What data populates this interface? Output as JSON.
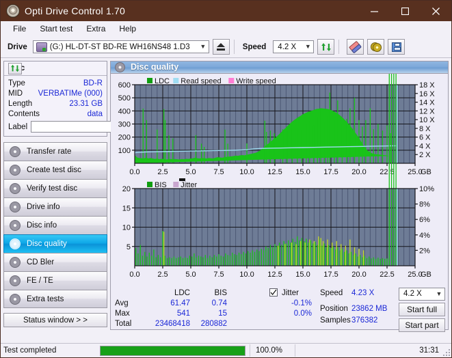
{
  "window": {
    "title": "Opti Drive Control 1.70",
    "minimize": "—",
    "maximize": "□",
    "close": "✕"
  },
  "menu": [
    "File",
    "Start test",
    "Extra",
    "Help"
  ],
  "toolbar": {
    "drive_label": "Drive",
    "drive_value": "(G:)  HL-DT-ST BD-RE  WH16NS48 1.D3",
    "eject_title": "Eject",
    "speed_label": "Speed",
    "speed_value": "4.2 X",
    "refresh_title": "Refresh",
    "erase_title": "Erase",
    "disc_title": "Disc tools",
    "save_title": "Save"
  },
  "disc": {
    "header": "Disc",
    "refresh_title": "Refresh disc info",
    "rows": [
      {
        "key": "Type",
        "value": "BD-R"
      },
      {
        "key": "MID",
        "value": "VERBATIMe (000)"
      },
      {
        "key": "Length",
        "value": "23.31 GB"
      },
      {
        "key": "Contents",
        "value": "data"
      }
    ],
    "label_key": "Label",
    "label_value": "",
    "label_placeholder": ""
  },
  "nav": [
    {
      "label": "Transfer rate",
      "selected": false
    },
    {
      "label": "Create test disc",
      "selected": false
    },
    {
      "label": "Verify test disc",
      "selected": false
    },
    {
      "label": "Drive info",
      "selected": false
    },
    {
      "label": "Disc info",
      "selected": false
    },
    {
      "label": "Disc quality",
      "selected": true
    },
    {
      "label": "CD Bler",
      "selected": false
    },
    {
      "label": "FE / TE",
      "selected": false
    },
    {
      "label": "Extra tests",
      "selected": false
    }
  ],
  "status_window_button": "Status window > >",
  "panel": {
    "title": "Disc quality"
  },
  "stats": {
    "col_ldc": "LDC",
    "col_bis": "BIS",
    "rows": [
      {
        "key": "Avg",
        "ldc": "61.47",
        "bis": "0.74"
      },
      {
        "key": "Max",
        "ldc": "541",
        "bis": "15"
      },
      {
        "key": "Total",
        "ldc": "23468418",
        "bis": "280882"
      }
    ],
    "jitter_label": "Jitter",
    "jitter_checked": true,
    "jitter_avg": "-0.1%",
    "jitter_max": "0.0%",
    "speed_key": "Speed",
    "speed_value": "4.23 X",
    "position_key": "Position",
    "position_value": "23862 MB",
    "samples_key": "Samples",
    "samples_value": "376382",
    "speed_select": "4.2 X",
    "start_full": "Start full",
    "start_part": "Start part"
  },
  "statusbar": {
    "text": "Test completed",
    "progress_pct": 100,
    "percent_label": "100.0%",
    "time": "31:31"
  },
  "colors": {
    "title_bar": "#58301f",
    "plot_bg": "#6e7c96",
    "ldc_green": "#19c319",
    "read_speed": "#9fdcf2",
    "write_speed": "#ff7ed4",
    "jitter": "#c9a6cf",
    "value_blue": "#1a27d6",
    "progress_green": "#18a018",
    "sel_blue": "#0fa8e8"
  },
  "chart_data": [
    {
      "type": "area",
      "id": "ldc-chart",
      "title": "",
      "legend": [
        {
          "label": "LDC",
          "color": "#119e11"
        },
        {
          "label": "Read speed",
          "color": "#9fdcf2"
        },
        {
          "label": "Write speed",
          "color": "#ff7ed4"
        }
      ],
      "legend_position": "top-left",
      "xlabel": "GB",
      "ylabel": "",
      "xlim": [
        0.0,
        25.0
      ],
      "xticks": [
        0.0,
        2.5,
        5.0,
        7.5,
        10.0,
        12.5,
        15.0,
        17.5,
        20.0,
        22.5,
        25.0
      ],
      "xticklabels": [
        "0.0",
        "2.5",
        "5.0",
        "7.5",
        "10.0",
        "12.5",
        "15.0",
        "17.5",
        "20.0",
        "22.5",
        "25.0"
      ],
      "ylim": [
        0,
        600
      ],
      "yticks": [
        100,
        200,
        300,
        400,
        500,
        600
      ],
      "yticklabels": [
        "100",
        "200",
        "300",
        "400",
        "500",
        "600"
      ],
      "y2lim": [
        0,
        18
      ],
      "y2ticks": [
        2,
        4,
        6,
        8,
        10,
        12,
        14,
        16,
        18
      ],
      "y2ticklabels": [
        "2 X",
        "4 X",
        "6 X",
        "8 X",
        "10 X",
        "12 X",
        "14 X",
        "16 X",
        "18 X"
      ],
      "grid": true,
      "data_end_gb": 23.4,
      "series": [
        {
          "name": "LDC",
          "color": "#19c319",
          "type": "area",
          "x": [
            0.0,
            0.2,
            0.4,
            0.6,
            0.8,
            1.0,
            1.2,
            1.4,
            1.6,
            1.8,
            2.0,
            2.2,
            2.4,
            2.6,
            2.8,
            3.0,
            3.2,
            3.4,
            3.6,
            3.8,
            4.0,
            4.2,
            4.4,
            4.6,
            4.8,
            5.0,
            5.2,
            5.4,
            5.6,
            5.8,
            6.0,
            6.2,
            6.4,
            6.6,
            6.8,
            7.0,
            7.2,
            7.4,
            7.6,
            7.8,
            8.0,
            8.2,
            8.4,
            8.6,
            8.8,
            9.0,
            9.2,
            9.4,
            9.6,
            9.8,
            10.0,
            10.2,
            10.4,
            10.6,
            10.8,
            11.0,
            11.2,
            11.4,
            11.6,
            11.8,
            12.0,
            12.2,
            12.4,
            12.6,
            12.8,
            13.0,
            13.2,
            13.4,
            13.6,
            13.8,
            14.0,
            14.2,
            14.4,
            14.6,
            14.8,
            15.0,
            15.2,
            15.4,
            15.6,
            15.8,
            16.0,
            16.2,
            16.4,
            16.6,
            16.8,
            17.0,
            17.2,
            17.4,
            17.6,
            17.8,
            18.0,
            18.2,
            18.4,
            18.6,
            18.8,
            19.0,
            19.2,
            19.4,
            19.6,
            19.8,
            20.0,
            20.2,
            20.4,
            20.6,
            20.8,
            21.0,
            21.2,
            21.4,
            21.6,
            21.8,
            22.0,
            22.2,
            22.4,
            22.6,
            22.8,
            23.0,
            23.2,
            23.4
          ],
          "y": [
            60,
            42,
            38,
            36,
            34,
            40,
            34,
            38,
            34,
            30,
            34,
            28,
            32,
            30,
            26,
            28,
            30,
            28,
            30,
            28,
            26,
            30,
            28,
            32,
            30,
            34,
            36,
            40,
            36,
            34,
            38,
            36,
            34,
            38,
            36,
            34,
            40,
            44,
            42,
            40,
            44,
            46,
            48,
            50,
            52,
            56,
            54,
            58,
            60,
            58,
            62,
            66,
            70,
            74,
            78,
            86,
            96,
            110,
            126,
            140,
            152,
            168,
            182,
            196,
            212,
            228,
            246,
            262,
            280,
            296,
            312,
            326,
            338,
            350,
            360,
            372,
            380,
            388,
            394,
            400,
            406,
            412,
            414,
            418,
            416,
            414,
            412,
            408,
            400,
            392,
            382,
            370,
            356,
            340,
            322,
            304,
            284,
            262,
            238,
            214,
            188,
            160,
            132,
            108,
            92,
            80,
            72,
            68,
            66,
            64,
            62,
            60,
            58,
            56
          ]
        },
        {
          "name": "LDC spikes",
          "color": "#19c319",
          "type": "impulse",
          "x": [
            0.75,
            1.05,
            2.0,
            2.6,
            2.72,
            3.05,
            3.4,
            5.45,
            5.95,
            6.2,
            8.05,
            8.3,
            10.0,
            11.6,
            11.75,
            12.1,
            12.45,
            13.2,
            13.6,
            14.05,
            14.5,
            14.9,
            15.3,
            15.6,
            15.95,
            16.3,
            16.6,
            16.9,
            17.2,
            17.4,
            17.8,
            18.1,
            18.5,
            18.9,
            19.2,
            19.6,
            20.0,
            20.3,
            20.6,
            21.0,
            21.3,
            21.7,
            22.1,
            22.5,
            22.8,
            23.1
          ],
          "y": [
            418,
            330,
            258,
            414,
            330,
            214,
            190,
            215,
            150,
            125,
            257,
            150,
            152,
            325,
            240,
            250,
            230,
            260,
            245,
            300,
            270,
            255,
            300,
            325,
            290,
            350,
            420,
            310,
            360,
            540,
            330,
            480,
            300,
            340,
            420,
            500,
            330,
            280,
            330,
            420,
            260,
            300,
            250,
            290,
            230,
            200
          ]
        },
        {
          "name": "Read speed",
          "color": "#9fdcf2",
          "type": "line",
          "axis": "right",
          "x": [
            0.0,
            0.3,
            1.0,
            2.0,
            3.0,
            4.0,
            5.0,
            6.0,
            7.0,
            8.0,
            9.0,
            10.0,
            10.6,
            11.2,
            12.0,
            13.0,
            14.0,
            15.0,
            16.0,
            17.0,
            18.0,
            19.0,
            20.0,
            21.0,
            22.0,
            23.0,
            23.4
          ],
          "y": [
            2.4,
            2.5,
            2.6,
            2.65,
            2.7,
            2.75,
            2.8,
            2.85,
            2.9,
            2.95,
            3.0,
            3.1,
            3.3,
            3.4,
            3.45,
            3.5,
            3.55,
            3.6,
            3.65,
            3.7,
            3.75,
            3.8,
            3.85,
            3.9,
            3.95,
            4.0,
            4.0
          ]
        }
      ],
      "cursor_gb": 23.4
    },
    {
      "type": "area",
      "id": "bis-chart",
      "title": "",
      "legend": [
        {
          "label": "BIS",
          "color": "#119e11"
        },
        {
          "label": "Jitter",
          "color": "#c9a6cf"
        }
      ],
      "legend_position": "top-left",
      "xlabel": "GB",
      "xlim": [
        0.0,
        25.0
      ],
      "xticks": [
        0.0,
        2.5,
        5.0,
        7.5,
        10.0,
        12.5,
        15.0,
        17.5,
        20.0,
        22.5,
        25.0
      ],
      "xticklabels": [
        "0.0",
        "2.5",
        "5.0",
        "7.5",
        "10.0",
        "12.5",
        "15.0",
        "17.5",
        "20.0",
        "22.5",
        "25.0"
      ],
      "ylim": [
        0,
        20
      ],
      "yticks": [
        5,
        10,
        15,
        20
      ],
      "yticklabels": [
        "5",
        "10",
        "15",
        "20"
      ],
      "y2lim": [
        0,
        10
      ],
      "y2ticks": [
        2,
        4,
        6,
        8,
        10
      ],
      "y2ticklabels": [
        "2%",
        "4%",
        "6%",
        "8%",
        "10%"
      ],
      "grid": true,
      "data_end_gb": 23.4,
      "series": [
        {
          "name": "BIS",
          "color": "#19c319",
          "type": "impulse",
          "x": [
            0.1,
            0.3,
            0.5,
            0.7,
            0.9,
            1.1,
            1.3,
            1.5,
            1.7,
            1.9,
            2.1,
            2.3,
            2.5,
            2.7,
            2.9,
            3.1,
            3.3,
            3.5,
            3.7,
            3.9,
            4.1,
            4.3,
            4.5,
            4.7,
            4.9,
            5.1,
            5.3,
            5.5,
            5.7,
            5.9,
            6.1,
            6.3,
            6.5,
            6.7,
            6.9,
            7.1,
            7.3,
            7.5,
            7.7,
            7.9,
            8.1,
            8.3,
            8.5,
            8.7,
            8.9,
            9.1,
            9.3,
            9.5,
            9.7,
            9.9,
            10.1,
            10.3,
            10.5,
            10.7,
            10.9,
            11.1,
            11.3,
            11.5,
            11.7,
            11.9,
            12.1,
            12.3,
            12.5,
            12.7,
            12.9,
            13.1,
            13.3,
            13.5,
            13.7,
            13.9,
            14.1,
            14.3,
            14.5,
            14.7,
            14.9,
            15.1,
            15.3,
            15.5,
            15.7,
            15.9,
            16.1,
            16.3,
            16.5,
            16.7,
            16.9,
            17.1,
            17.3,
            17.5,
            17.7,
            17.9,
            18.1,
            18.3,
            18.5,
            18.7,
            18.9,
            19.1,
            19.3,
            19.5,
            19.7,
            19.9,
            20.1,
            20.3,
            20.5,
            20.7,
            20.9,
            21.1,
            21.3,
            21.5,
            21.7,
            21.9,
            22.1,
            22.3,
            22.5,
            22.7,
            22.9,
            23.1,
            23.3
          ],
          "y": [
            4.6,
            3.2,
            5.4,
            2.6,
            3.6,
            2.4,
            3.4,
            2.6,
            4.2,
            2.2,
            2.8,
            2.2,
            9.0,
            2.6,
            2.0,
            2.2,
            2.0,
            2.4,
            2.0,
            2.2,
            2.4,
            2.0,
            2.2,
            2.0,
            2.6,
            2.4,
            3.2,
            2.2,
            2.6,
            2.4,
            2.2,
            2.8,
            2.0,
            2.6,
            2.2,
            2.8,
            2.4,
            3.0,
            2.6,
            2.4,
            3.2,
            2.8,
            2.6,
            3.4,
            3.0,
            2.8,
            3.4,
            3.0,
            3.6,
            3.2,
            3.8,
            3.4,
            4.0,
            3.6,
            4.2,
            3.8,
            4.4,
            4.0,
            5.0,
            4.6,
            5.4,
            4.8,
            5.6,
            5.2,
            6.0,
            5.4,
            6.4,
            5.8,
            6.6,
            6.0,
            7.0,
            6.2,
            7.6,
            6.6,
            7.2,
            6.4,
            7.0,
            6.0,
            6.6,
            5.8,
            6.2,
            5.4,
            6.8,
            5.2,
            5.8,
            4.8,
            5.4,
            4.6,
            5.0,
            4.2,
            4.8,
            4.0,
            4.4,
            3.6,
            4.0,
            3.2,
            3.6,
            2.8,
            3.2,
            2.4,
            2.8,
            2.2,
            2.6,
            2.0,
            2.4,
            1.9,
            2.2,
            1.8,
            2.1,
            1.8,
            2.0,
            1.8,
            1.9
          ]
        },
        {
          "name": "Jitter",
          "color": "#c9dd22",
          "type": "impulse",
          "axis": "right",
          "x": [
            2.6,
            12.8,
            13.4,
            14.0,
            14.4,
            14.8,
            15.2,
            15.6,
            16.0,
            16.4,
            16.6,
            16.8,
            17.2,
            17.6,
            18.0,
            18.4,
            18.8,
            19.2,
            19.6,
            20.0,
            20.4
          ],
          "y": [
            4.4,
            2.6,
            2.8,
            3.0,
            2.8,
            3.2,
            3.0,
            3.4,
            3.2,
            3.8,
            3.6,
            3.2,
            3.4,
            3.0,
            3.2,
            2.8,
            2.6,
            3.4,
            2.4,
            2.2,
            2.0
          ]
        }
      ],
      "cursor_gb": 23.4
    }
  ]
}
